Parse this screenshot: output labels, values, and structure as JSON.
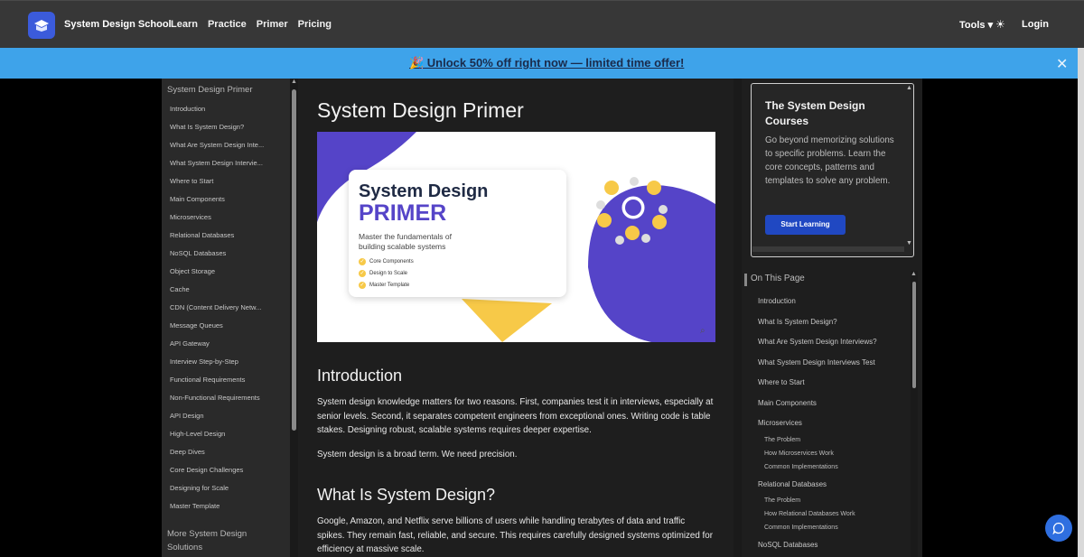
{
  "nav": {
    "brand": "System Design School",
    "links": [
      "Learn",
      "Practice",
      "Primer",
      "Pricing"
    ],
    "tools": "Tools ▾",
    "login": "Login"
  },
  "promo": {
    "text": "🎉 Unlock 50% off right now — limited time offer!"
  },
  "leftnav": {
    "title": "System Design Primer",
    "items": [
      "Introduction",
      "What Is System Design?",
      "What Are System Design Inte...",
      "What System Design Intervie...",
      "Where to Start",
      "Main Components",
      "Microservices",
      "Relational Databases",
      "NoSQL Databases",
      "Object Storage",
      "Cache",
      "CDN (Content Delivery Netw...",
      "Message Queues",
      "API Gateway",
      "Interview Step-by-Step",
      "Functional Requirements",
      "Non-Functional Requirements",
      "API Design",
      "High-Level Design",
      "Deep Dives",
      "Core Design Challenges",
      "Designing for Scale",
      "Master Template"
    ],
    "more": "More System Design Solutions"
  },
  "main": {
    "title": "System Design Primer",
    "hero": {
      "line1": "System Design",
      "line2": "PRIMER",
      "subtitle1": "Master the fundamentals of",
      "subtitle2": "building scalable systems",
      "bullets": [
        "Core Components",
        "Design to Scale",
        "Master Template"
      ]
    },
    "intro_heading": "Introduction",
    "intro_p1": "System design knowledge matters for two reasons. First, companies test it in interviews, especially at senior levels. Second, it separates competent engineers from exceptional ones. Writing code is table stakes. Designing robust, scalable systems requires deeper expertise.",
    "intro_p2": "System design is a broad term. We need precision.",
    "what_heading": "What Is System Design?",
    "what_p1": "Google, Amazon, and Netflix serve billions of users while handling terabytes of data and traffic spikes. They remain fast, reliable, and secure. This requires carefully designed systems optimized for efficiency at massive scale."
  },
  "course": {
    "title": "The System Design Courses",
    "desc": "Go beyond memorizing solutions to specific problems. Learn the core concepts, patterns and templates to solve any problem.",
    "button": "Start Learning"
  },
  "toc": {
    "title": "On This Page",
    "items": [
      "Introduction",
      "What Is System Design?",
      "What Are System Design Interviews?",
      "What System Design Interviews Test",
      "Where to Start",
      "Main Components",
      "Microservices"
    ],
    "micro_subs": [
      "The Problem",
      "How Microservices Work",
      "Common Implementations"
    ],
    "rel": "Relational Databases",
    "rel_subs": [
      "The Problem",
      "How Relational Databases Work",
      "Common Implementations"
    ],
    "nosql": "NoSQL Databases"
  },
  "colors": {
    "accent": "#3b5bdb",
    "banner": "#3ea3ea",
    "primer_purple": "#5544c8",
    "primer_yellow": "#f7c948"
  }
}
